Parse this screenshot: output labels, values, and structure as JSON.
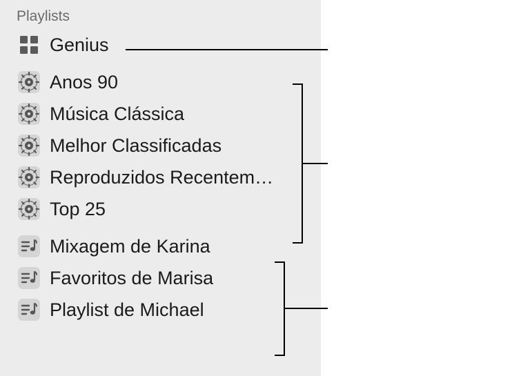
{
  "sidebar": {
    "section_header": "Playlists",
    "items": [
      {
        "type": "genius",
        "label": "Genius"
      },
      {
        "type": "smart",
        "label": "Anos 90"
      },
      {
        "type": "smart",
        "label": "Música Clássica"
      },
      {
        "type": "smart",
        "label": "Melhor Classificadas"
      },
      {
        "type": "smart",
        "label": "Reproduzidos Recentem…"
      },
      {
        "type": "smart",
        "label": "Top 25"
      },
      {
        "type": "regular",
        "label": "Mixagem de Karina"
      },
      {
        "type": "regular",
        "label": "Favoritos de Marisa"
      },
      {
        "type": "regular",
        "label": "Playlist de Michael"
      }
    ]
  }
}
